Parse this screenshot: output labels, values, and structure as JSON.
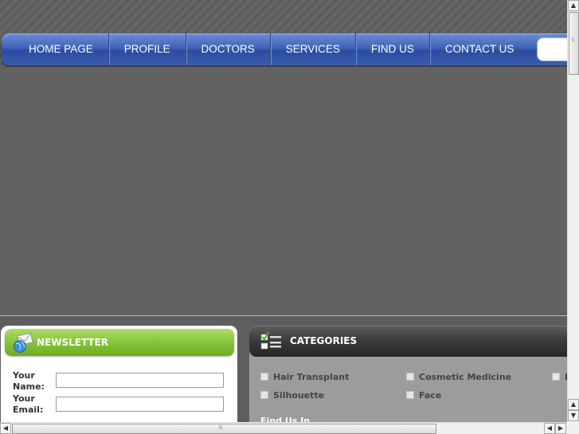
{
  "nav": {
    "items": [
      "HOME PAGE",
      "PROFILE",
      "DOCTORS",
      "SERVICES",
      "FIND US",
      "CONTACT US"
    ]
  },
  "newsletter": {
    "title": "NEWSLETTER",
    "name_label": "Your Name:",
    "email_label": "Your Email:",
    "name_value": "",
    "email_value": ""
  },
  "categories": {
    "title": "CATEGORIES",
    "items": [
      "Hair Transplant",
      "Cosmetic Medicine",
      "B",
      "Silhouette",
      "Face"
    ],
    "find_us": "Find Us In"
  },
  "colors": {
    "nav_blue": "#3f62b8",
    "newsletter_green": "#86c33a",
    "categories_dark": "#3a3a3a"
  }
}
